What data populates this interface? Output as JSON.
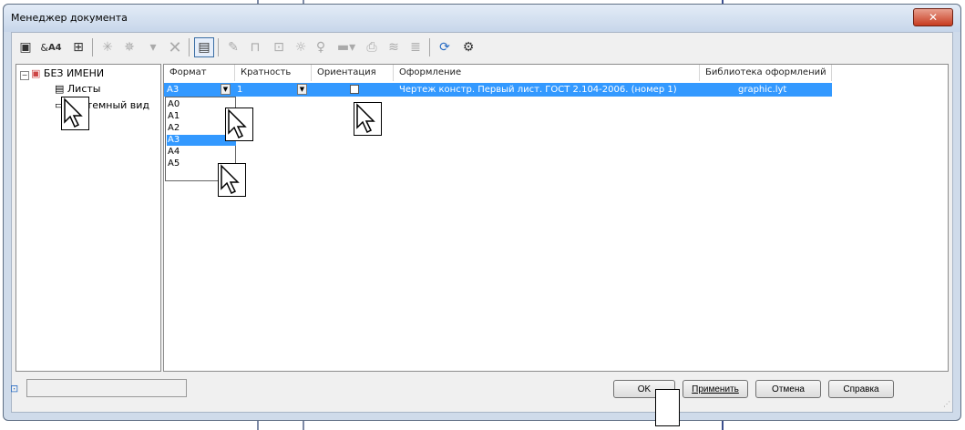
{
  "window": {
    "title": "Менеджер документа",
    "close_icon": "close-icon"
  },
  "toolbar": {
    "icons": [
      "new-sheet-icon",
      "format-a4-icon",
      "sheet-params-icon",
      "hatch-icon",
      "hatch-multi-icon",
      "filter-icon",
      "delete-x-icon",
      "table-view-icon",
      "pen-check-icon",
      "unlock-icon",
      "lock-icon",
      "bulb-on-icon",
      "bulb-off-icon",
      "color-line-icon",
      "print-icon",
      "print-stack-icon",
      "check-stack-icon",
      "refresh-icon",
      "settings-icon"
    ],
    "format_label": "A4"
  },
  "tree": {
    "root_label": "БЕЗ ИМЕНИ",
    "children": [
      "Листы",
      "Системный вид"
    ]
  },
  "grid": {
    "headers": [
      "Формат",
      "Кратность",
      "Ориентация",
      "Оформление",
      "Библиотека оформлений"
    ],
    "row": {
      "format": "A3",
      "multiplicity": "1",
      "design": "Чертеж констр. Первый лист. ГОСТ 2.104-2006. (номер 1)",
      "library": "graphic.lyt"
    },
    "dropdown_options": [
      "A0",
      "A1",
      "A2",
      "A3",
      "A4",
      "A5"
    ],
    "dropdown_selected": "A3"
  },
  "buttons": {
    "ok": "OK",
    "apply": "Применить",
    "cancel": "Отмена",
    "help": "Справка"
  },
  "colors": {
    "selection": "#3399ff",
    "close": "#c73b1f"
  }
}
